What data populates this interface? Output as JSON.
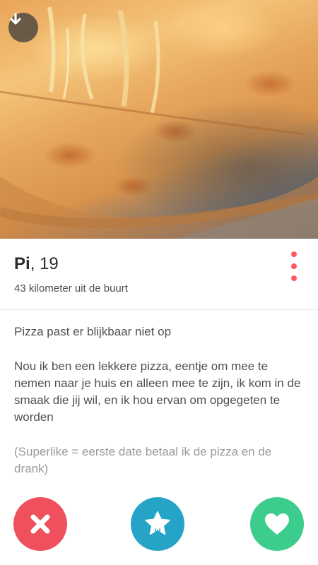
{
  "photo": {
    "alt": "pizza photo",
    "download_icon": "download-icon"
  },
  "profile": {
    "name": "Pi",
    "age_text": ", 19",
    "distance": "43 kilometer uit de buurt",
    "more_icon": "more-vertical-icon"
  },
  "bio": {
    "paragraphs": [
      "Pizza past er blijkbaar niet op",
      "Nou ik ben een lekkere pizza, eentje om mee te nemen naar je huis en alleen mee te zijn, ik kom in de smaak die jij wil, en ik hou ervan om opgegeten te worden"
    ],
    "footnote": "(Superlike = eerste date betaal ik de pizza en de drank)"
  },
  "actions": {
    "nope_icon": "close-icon",
    "superlike_icon": "star-icon",
    "like_icon": "heart-icon"
  },
  "colors": {
    "accent": "#ff5864",
    "nope": "#f0505c",
    "superlike": "#25a4c8",
    "like": "#3ccd8c"
  }
}
